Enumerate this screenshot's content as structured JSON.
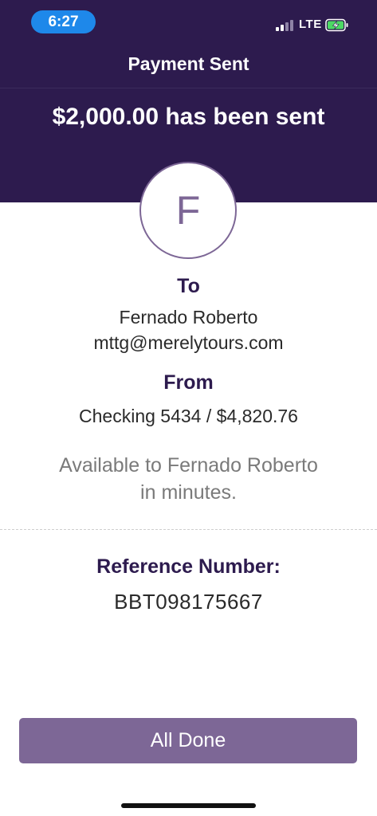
{
  "status_bar": {
    "time": "6:27",
    "network": "LTE",
    "icons": [
      "signal-icon",
      "battery-charging-icon"
    ]
  },
  "header": {
    "title": "Payment Sent",
    "amount_message": "$2,000.00 has been sent",
    "background_color": "#2d1b4e"
  },
  "recipient": {
    "avatar_initial": "F",
    "to_heading": "To",
    "name": "Fernado Roberto",
    "email": "mttg@merelytours.com"
  },
  "source": {
    "from_heading": "From",
    "account": "Checking 5434 / $4,820.76"
  },
  "availability": {
    "line1": "Available to Fernado Roberto",
    "line2": "in minutes."
  },
  "reference": {
    "heading": "Reference Number:",
    "value": "BBT098175667"
  },
  "actions": {
    "done_label": "All Done",
    "accent_color": "#7d6796"
  }
}
